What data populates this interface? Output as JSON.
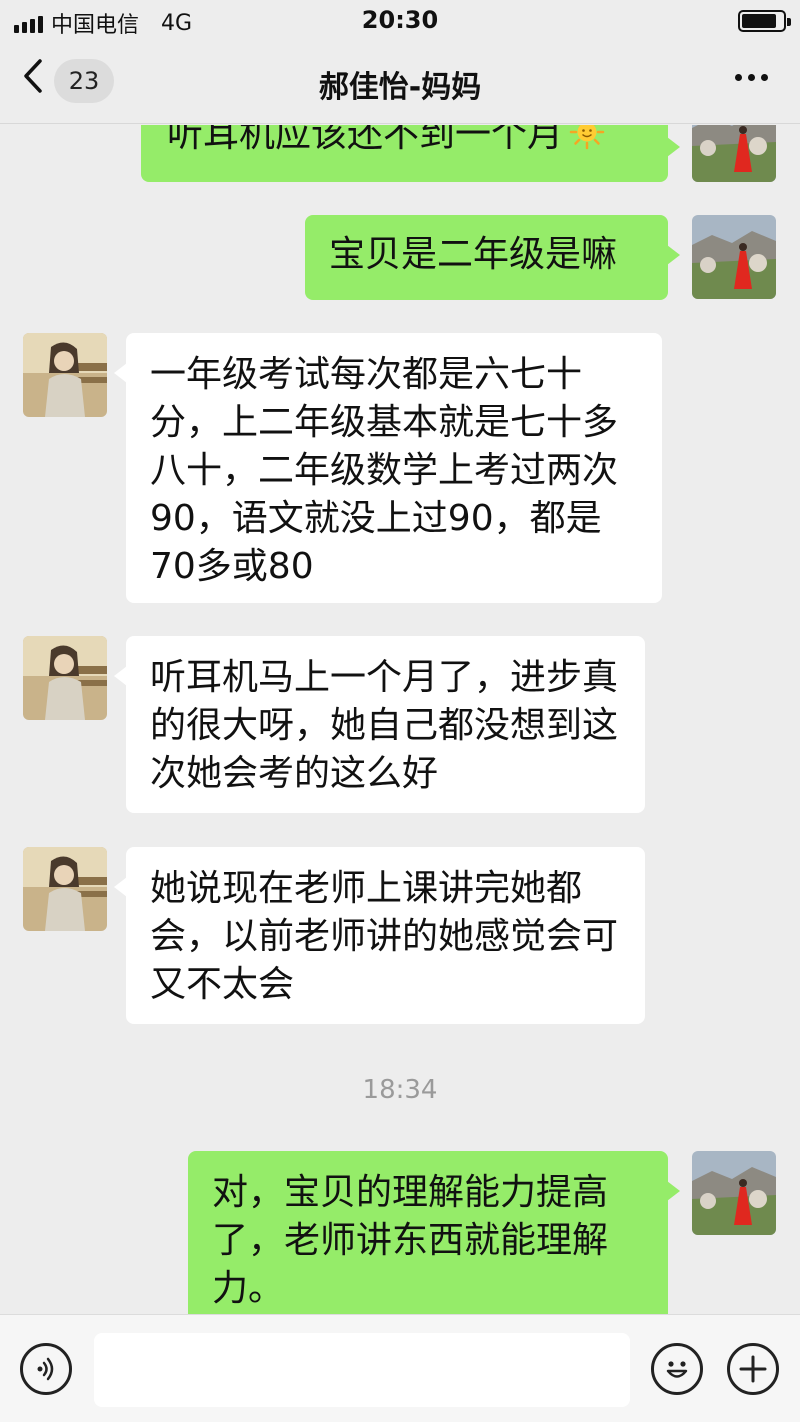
{
  "status_bar": {
    "carrier": "中国电信",
    "network": "4G",
    "time": "20:30",
    "battery_level": 0.85
  },
  "nav": {
    "back_icon": "chevron-left-icon",
    "unread_count": "23",
    "title": "郝佳怡-妈妈",
    "more_icon": "more-dots-icon"
  },
  "messages": [
    {
      "sender": "me",
      "text": "听耳机应该还不到一个月",
      "emoji": "sun-emoji"
    },
    {
      "sender": "me",
      "text": "宝贝是二年级是嘛"
    },
    {
      "sender": "other",
      "text": "一年级考试每次都是六七十分，上二年级基本就是七十多八十，二年级数学上考过两次90，语文就没上过90，都是70多或80"
    },
    {
      "sender": "other",
      "text": "听耳机马上一个月了，进步真的很大呀，她自己都没想到这次她会考的这么好"
    },
    {
      "sender": "other",
      "text": "她说现在老师上课讲完她都会，以前老师讲的她感觉会可又不太会"
    },
    {
      "type": "time",
      "text": "18:34"
    },
    {
      "sender": "me",
      "text": "对，宝贝的理解能力提高了，老师讲东西就能理解力。"
    }
  ],
  "input_bar": {
    "voice_icon": "voice-icon",
    "input_value": "",
    "emoji_icon": "emoji-icon",
    "plus_icon": "plus-icon"
  },
  "colors": {
    "background": "#ededed",
    "my_bubble": "#95ec69",
    "other_bubble": "#ffffff"
  }
}
